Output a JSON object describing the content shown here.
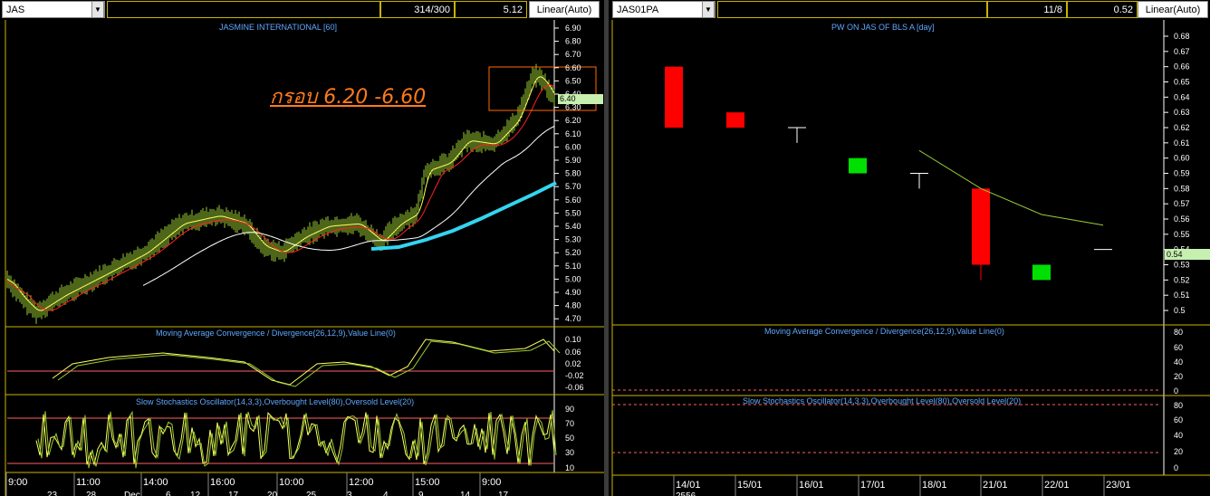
{
  "left": {
    "symbol": "JAS",
    "counter": "314/300",
    "last": "5.12",
    "scale_mode": "Linear(Auto)",
    "main_title": "JASMINE INTERNATIONAL [60]",
    "annotation": "กรอบ 6.20 -6.60",
    "price_badge": "6.40",
    "macd_title": "Moving Average Convergence / Divergence(26,12,9),Value Line(0)",
    "stoch_title": "Slow Stochastics Oscillator(14,3,3),Overbought Level(80),Oversold Level(20)",
    "time_labels": [
      "9:00",
      "11:00",
      "14:00",
      "16:00",
      "10:00",
      "12:00",
      "15:00",
      "9:00"
    ],
    "date_labels": [
      "23",
      "28",
      "Dec",
      "6",
      "12",
      "17",
      "20",
      "25",
      "3",
      "4",
      "9",
      "14",
      "17"
    ],
    "price_ticks": [
      "6.90",
      "6.80",
      "6.70",
      "6.60",
      "6.50",
      "6.40",
      "6.30",
      "6.20",
      "6.10",
      "6.00",
      "5.90",
      "5.80",
      "5.70",
      "5.60",
      "5.50",
      "5.40",
      "5.30",
      "5.20",
      "5.10",
      "5.00",
      "4.90",
      "4.80",
      "4.70"
    ],
    "macd_ticks": [
      "0.10",
      "0.06",
      "0.02",
      "-0.02",
      "-0.06"
    ],
    "stoch_ticks": [
      "90",
      "70",
      "50",
      "30",
      "10"
    ],
    "colors": {
      "bars": "#9acd32",
      "red": "#ff2020",
      "white": "#ffffff",
      "cyan": "#34d4f0",
      "box": "#ff6a00"
    }
  },
  "right": {
    "symbol": "JAS01PA",
    "counter": "11/8",
    "last": "0.52",
    "scale_mode": "Linear(Auto)",
    "main_title": "PW ON JAS OF BLS   A [day]",
    "price_badge": "0.54",
    "macd_title": "Moving Average Convergence / Divergence(26,12,9),Value Line(0)",
    "stoch_title": "Slow Stochastics Oscillator(14,3,3),Overbought Level(80),Oversold Level(20)",
    "date_labels": [
      "14/01",
      "15/01",
      "16/01",
      "17/01",
      "18/01",
      "21/01",
      "22/01",
      "23/01"
    ],
    "year_label": "2556",
    "price_ticks": [
      "0.68",
      "0.67",
      "0.66",
      "0.65",
      "0.64",
      "0.63",
      "0.62",
      "0.61",
      "0.60",
      "0.59",
      "0.58",
      "0.57",
      "0.56",
      "0.55",
      "0.54",
      "0.53",
      "0.52",
      "0.51",
      "0.5"
    ],
    "macd_ticks": [
      "80",
      "60",
      "40",
      "20",
      "0"
    ],
    "stoch_ticks": [
      "80",
      "60",
      "40",
      "20",
      "0"
    ],
    "candles": [
      {
        "date": "14/01",
        "open": 0.66,
        "close": 0.62,
        "high": 0.66,
        "low": 0.62
      },
      {
        "date": "15/01",
        "open": 0.63,
        "close": 0.62,
        "high": 0.63,
        "low": 0.62
      },
      {
        "date": "16/01",
        "open": 0.62,
        "close": 0.62,
        "high": 0.62,
        "low": 0.61
      },
      {
        "date": "17/01",
        "open": 0.59,
        "close": 0.6,
        "high": 0.6,
        "low": 0.59
      },
      {
        "date": "18/01",
        "open": 0.59,
        "close": 0.59,
        "high": 0.59,
        "low": 0.58
      },
      {
        "date": "21/01",
        "open": 0.58,
        "close": 0.53,
        "high": 0.58,
        "low": 0.52
      },
      {
        "date": "22/01",
        "open": 0.52,
        "close": 0.53,
        "high": 0.53,
        "low": 0.52
      },
      {
        "date": "23/01",
        "open": 0.54,
        "close": 0.54,
        "high": 0.54,
        "low": 0.54
      }
    ],
    "ma_line": [
      {
        "date": "18/01",
        "value": 0.605
      },
      {
        "date": "21/01",
        "value": 0.58
      },
      {
        "date": "22/01",
        "value": 0.563
      },
      {
        "date": "23/01",
        "value": 0.556
      }
    ],
    "colors": {
      "up": "#00e000",
      "down": "#ff0000",
      "ma": "#9acd32"
    }
  }
}
